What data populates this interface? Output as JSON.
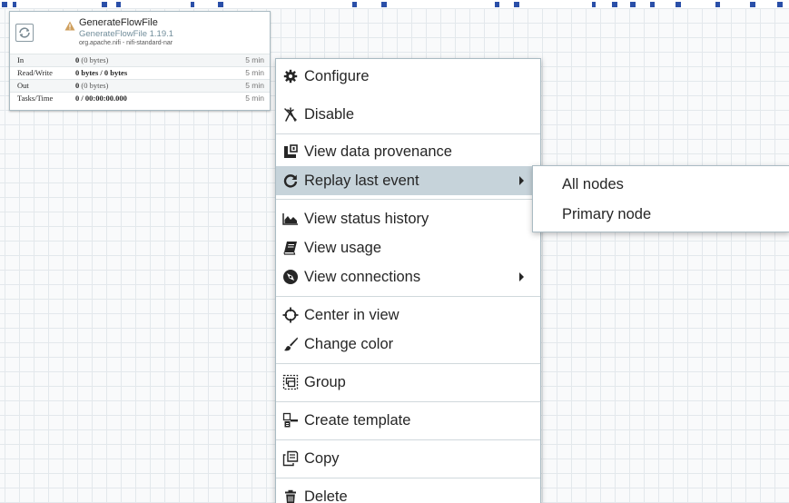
{
  "processor": {
    "name": "GenerateFlowFile",
    "type": "GenerateFlowFile 1.19.1",
    "bundle": "org.apache.nifi - nifi-standard-nar",
    "stats": [
      {
        "label": "In",
        "value": "0",
        "detail": "(0 bytes)",
        "time": "5 min"
      },
      {
        "label": "Read/Write",
        "value": "0 bytes / 0 bytes",
        "detail": "",
        "time": "5 min"
      },
      {
        "label": "Out",
        "value": "0",
        "detail": "(0 bytes)",
        "time": "5 min"
      },
      {
        "label": "Tasks/Time",
        "value": "0 / 00:00:00.000",
        "detail": "",
        "time": "5 min"
      }
    ]
  },
  "context_menu": {
    "items": [
      {
        "label": "Configure",
        "icon": "gear-icon"
      },
      {
        "label": "Disable",
        "icon": "disable-icon"
      },
      {
        "label": "View data provenance",
        "icon": "provenance-icon"
      },
      {
        "label": "Replay last event",
        "icon": "replay-icon",
        "submenu": true,
        "active": true
      },
      {
        "label": "View status history",
        "icon": "area-chart-icon"
      },
      {
        "label": "View usage",
        "icon": "book-icon"
      },
      {
        "label": "View connections",
        "icon": "compass-icon",
        "submenu": true
      },
      {
        "label": "Center in view",
        "icon": "crosshairs-icon"
      },
      {
        "label": "Change color",
        "icon": "paintbrush-icon"
      },
      {
        "label": "Group",
        "icon": "group-icon"
      },
      {
        "label": "Create template",
        "icon": "template-icon"
      },
      {
        "label": "Copy",
        "icon": "copy-icon"
      },
      {
        "label": "Delete",
        "icon": "trash-icon"
      }
    ]
  },
  "submenu": {
    "items": [
      {
        "label": "All nodes"
      },
      {
        "label": "Primary node"
      }
    ]
  },
  "colors": {
    "active_item_bg": "#c6d3da",
    "canvas_bg": "#f9fafb",
    "grid_line": "#e3e8ec",
    "warning": "#cf9f5d",
    "processor_type": "#728e9b",
    "top_text": "#2a4fa8"
  }
}
